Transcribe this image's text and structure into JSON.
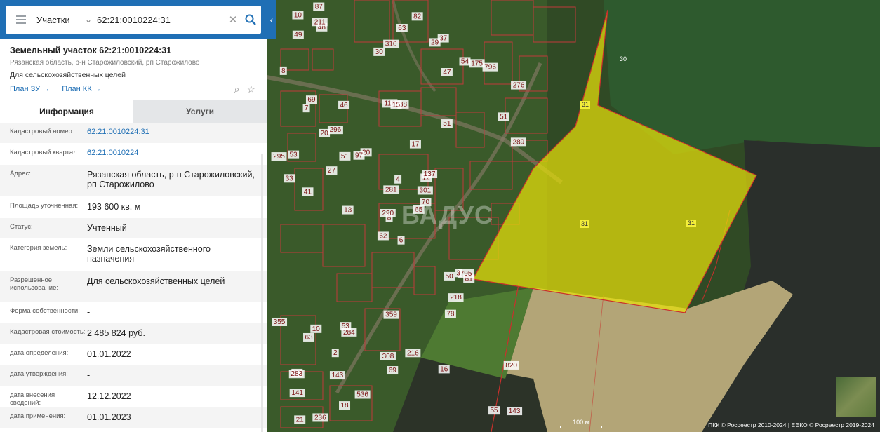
{
  "search": {
    "category": "Участки",
    "query": "62:21:0010224:31"
  },
  "parcel": {
    "title": "Земельный участок 62:21:0010224:31",
    "address_short": "Рязанская область, р-н Старожиловский, рп Старожилово",
    "purpose": "Для сельскохозяйственных целей",
    "plan_zu": "План ЗУ",
    "plan_kk": "План КК"
  },
  "tabs": [
    {
      "label": "Информация",
      "active": true
    },
    {
      "label": "Услуги",
      "active": false
    }
  ],
  "info_rows": [
    {
      "label": "Кадастровый номер:",
      "value": "62:21:0010224:31",
      "link": true
    },
    {
      "label": "Кадастровый квартал:",
      "value": "62:21:0010224",
      "link": true
    },
    {
      "label": "Адрес:",
      "value": "Рязанская область, р-н Старожиловский, рп Старожилово",
      "link": false
    },
    {
      "label": "Площадь уточненная:",
      "value": "193 600 кв. м",
      "link": false
    },
    {
      "label": "Статус:",
      "value": "Учтенный",
      "link": false
    },
    {
      "label": "Категория земель:",
      "value": "Земли сельскохозяйственного назначения",
      "link": false
    },
    {
      "label": "Разрешенное использование:",
      "value": "Для сельскохозяйственных целей",
      "link": false
    },
    {
      "label": "Форма собственности:",
      "value": "-",
      "link": false
    },
    {
      "label": "Кадастровая стоимость:",
      "value": "2 485 824 руб.",
      "link": false
    },
    {
      "label": "дата определения:",
      "value": "01.01.2022",
      "link": false
    },
    {
      "label": "дата утверждения:",
      "value": "-",
      "link": false
    },
    {
      "label": "дата внесения сведений:",
      "value": "12.12.2022",
      "link": false
    },
    {
      "label": "дата применения:",
      "value": "01.01.2023",
      "link": false
    }
  ],
  "map": {
    "parcel_labels": [
      "31",
      "31",
      "31",
      "30"
    ],
    "plot_numbers": [
      "6",
      "7",
      "8",
      "60",
      "12",
      "284",
      "37",
      "38",
      "47",
      "65",
      "48",
      "143",
      "41",
      "276",
      "62",
      "51",
      "236",
      "116",
      "17",
      "10",
      "20",
      "141",
      "143",
      "15",
      "137",
      "81",
      "69",
      "316",
      "33",
      "50",
      "289",
      "290",
      "308",
      "281",
      "46",
      "54",
      "53",
      "55",
      "820",
      "795",
      "82",
      "97",
      "27",
      "78",
      "18",
      "295",
      "301",
      "21",
      "69",
      "70",
      "63",
      "51",
      "8",
      "218",
      "16",
      "2",
      "211",
      "10",
      "216",
      "796",
      "63",
      "13",
      "53",
      "296",
      "175",
      "87",
      "29",
      "30",
      "4",
      "355",
      "359",
      "536",
      "3",
      "51",
      "283",
      "49",
      "20"
    ],
    "scale_label": "100 м",
    "credits": "ПКК © Росреестр 2010-2024 | ЕЭКО © Росреестр 2019-2024",
    "watermark": "ВАДУС",
    "colors": {
      "parcel_fill": "#e7e10a",
      "parcel_stroke": "#c9302c",
      "plot_stroke": "#c0393b",
      "accent": "#1f6fb5"
    }
  }
}
